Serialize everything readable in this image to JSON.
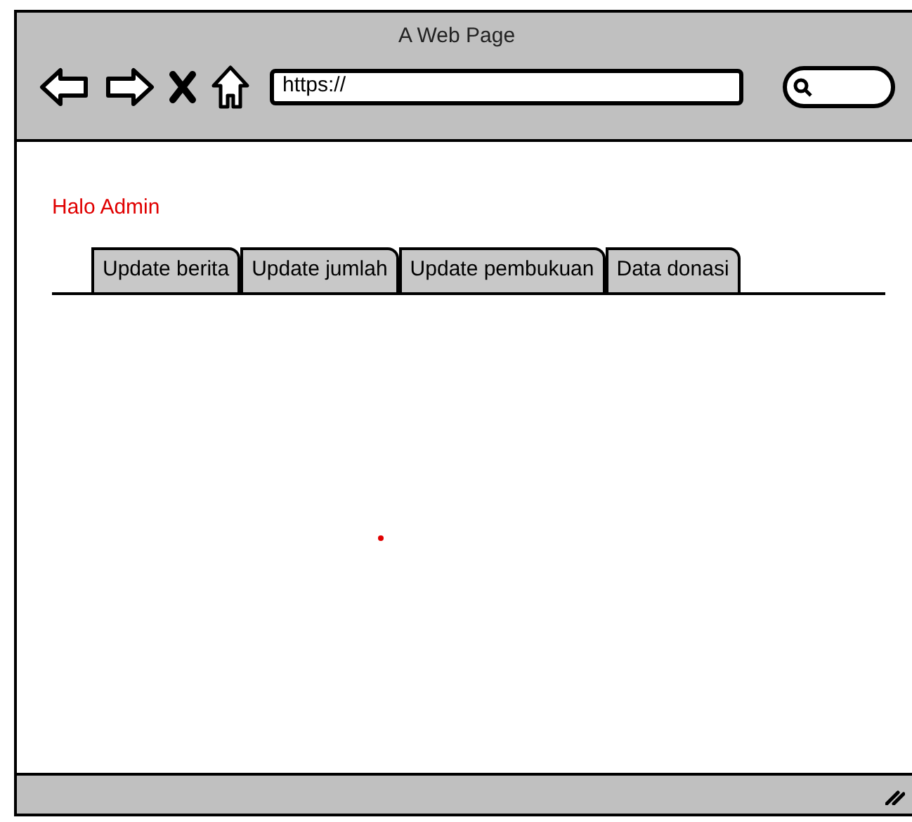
{
  "window": {
    "title": "A Web Page"
  },
  "address_bar": {
    "value": "https://"
  },
  "greeting": "Halo Admin",
  "tabs": [
    {
      "label": "Update berita"
    },
    {
      "label": "Update jumlah"
    },
    {
      "label": "Update pembukuan"
    },
    {
      "label": "Data donasi"
    }
  ]
}
